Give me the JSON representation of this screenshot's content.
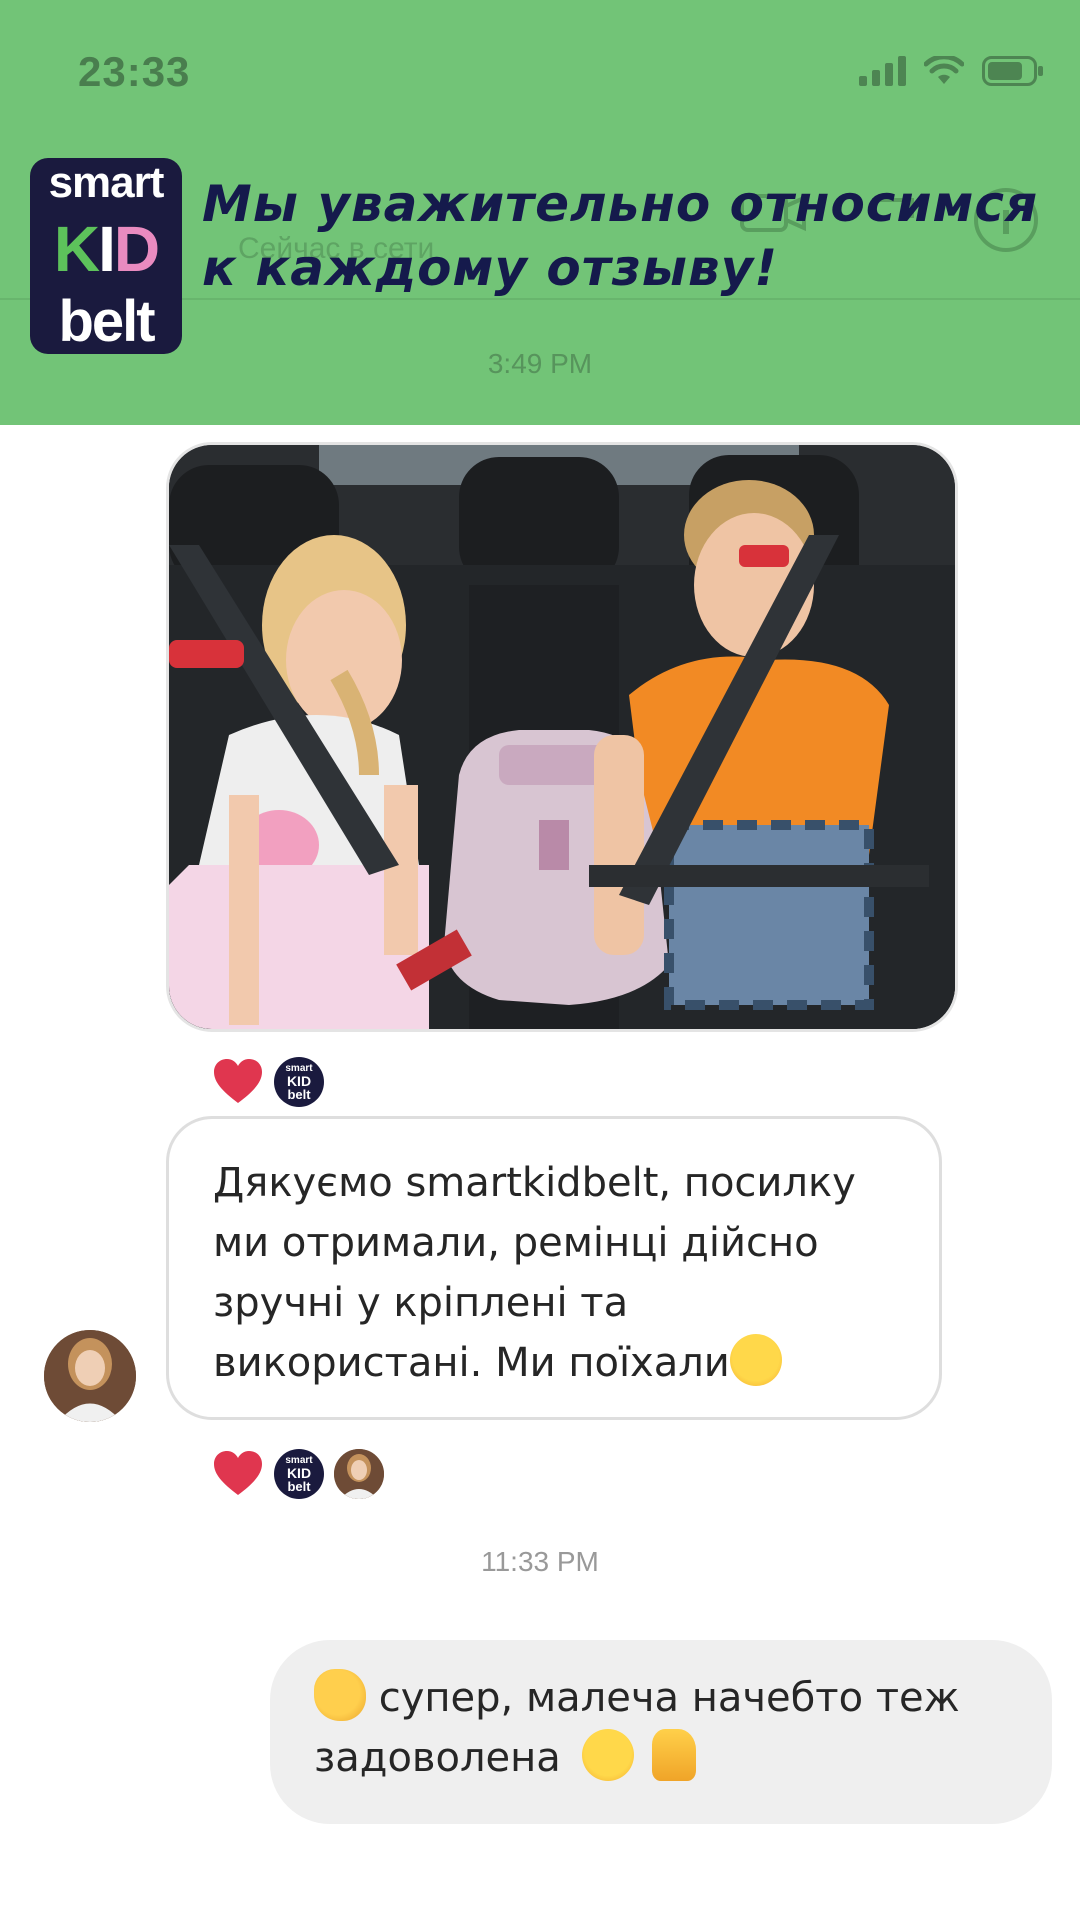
{
  "status_bar": {
    "time": "23:33"
  },
  "ghost_header": {
    "subtitle": "Сейчас в сети",
    "time": "3:49 PM"
  },
  "banner": {
    "logo": {
      "line1": "smart",
      "k": "K",
      "i": "I",
      "d": "D",
      "line3": "belt"
    },
    "headline": "Мы уважительно относимся\nк каждому отзыву!",
    "background": "#72c477",
    "text_color": "#151a4c"
  },
  "chat": {
    "message_in": {
      "text": "Дякуємо smartkidbelt, посилку ми отримали, ремінці дійсно зручні у кріплені та використані. Ми поїхали",
      "emoji": "hugging-face"
    },
    "time_label": "11:33 PM",
    "message_out": {
      "emoji_lead": "clapping-hands",
      "text_line1": "супер, малеча начебто теж",
      "text_line2": "задоволена",
      "emoji_trail": [
        "grinning-face",
        "thumbs-up"
      ]
    },
    "mini_logo": {
      "top": "smart",
      "mid": "KID",
      "bottom": "belt"
    }
  },
  "colors": {
    "heart": "#e0364f",
    "logo_bg": "#1a1a3e",
    "bubble_out_bg": "#efefef"
  }
}
